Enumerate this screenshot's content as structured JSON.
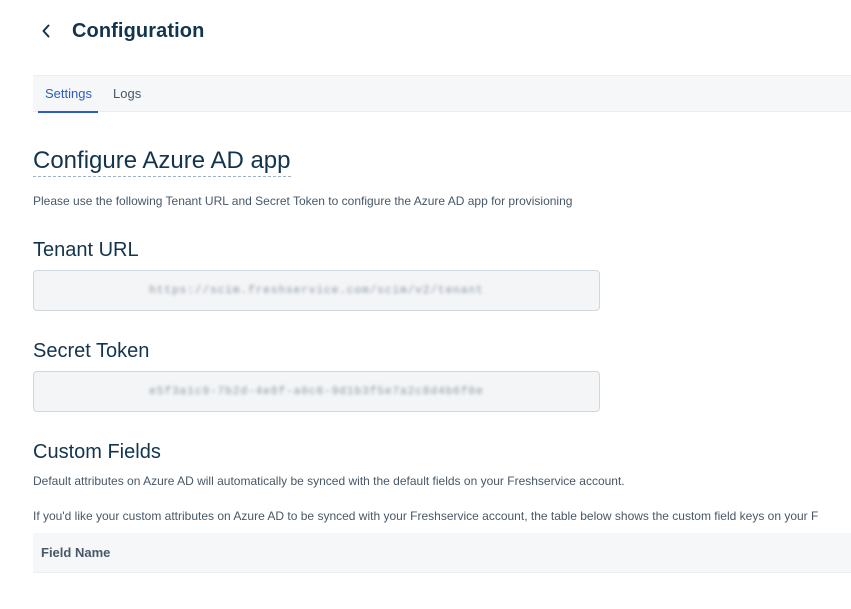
{
  "header": {
    "back_icon": "chevron-left-icon",
    "title": "Configuration"
  },
  "tabs": [
    {
      "label": "Settings",
      "active": true
    },
    {
      "label": "Logs",
      "active": false
    }
  ],
  "main": {
    "section_title": "Configure Azure AD app",
    "section_description": "Please use the following Tenant URL and Secret Token to configure the Azure AD app for provisioning",
    "tenant_url": {
      "label": "Tenant URL",
      "value": "https://scim.freshservice.com/scim/v2/tenant"
    },
    "secret_token": {
      "label": "Secret Token",
      "value": "e5f3a1c9-7b2d-4e8f-a0c6-9d1b3f5e7a2c8d4b6f0e"
    },
    "custom_fields": {
      "title": "Custom Fields",
      "description_1": "Default attributes on Azure AD will automatically be synced with the default fields on your Freshservice account.",
      "description_2": "If you'd like your custom attributes on Azure AD to be synced with your Freshservice account, the table below shows the custom field keys on your F",
      "table": {
        "columns": [
          "Field Name"
        ]
      }
    }
  },
  "colors": {
    "accent": "#2c5cc5",
    "heading": "#12344d",
    "muted_text": "#475867",
    "field_bg": "#f3f5f7",
    "field_border": "#cfd7df",
    "bar_bg": "#f5f7f9"
  }
}
